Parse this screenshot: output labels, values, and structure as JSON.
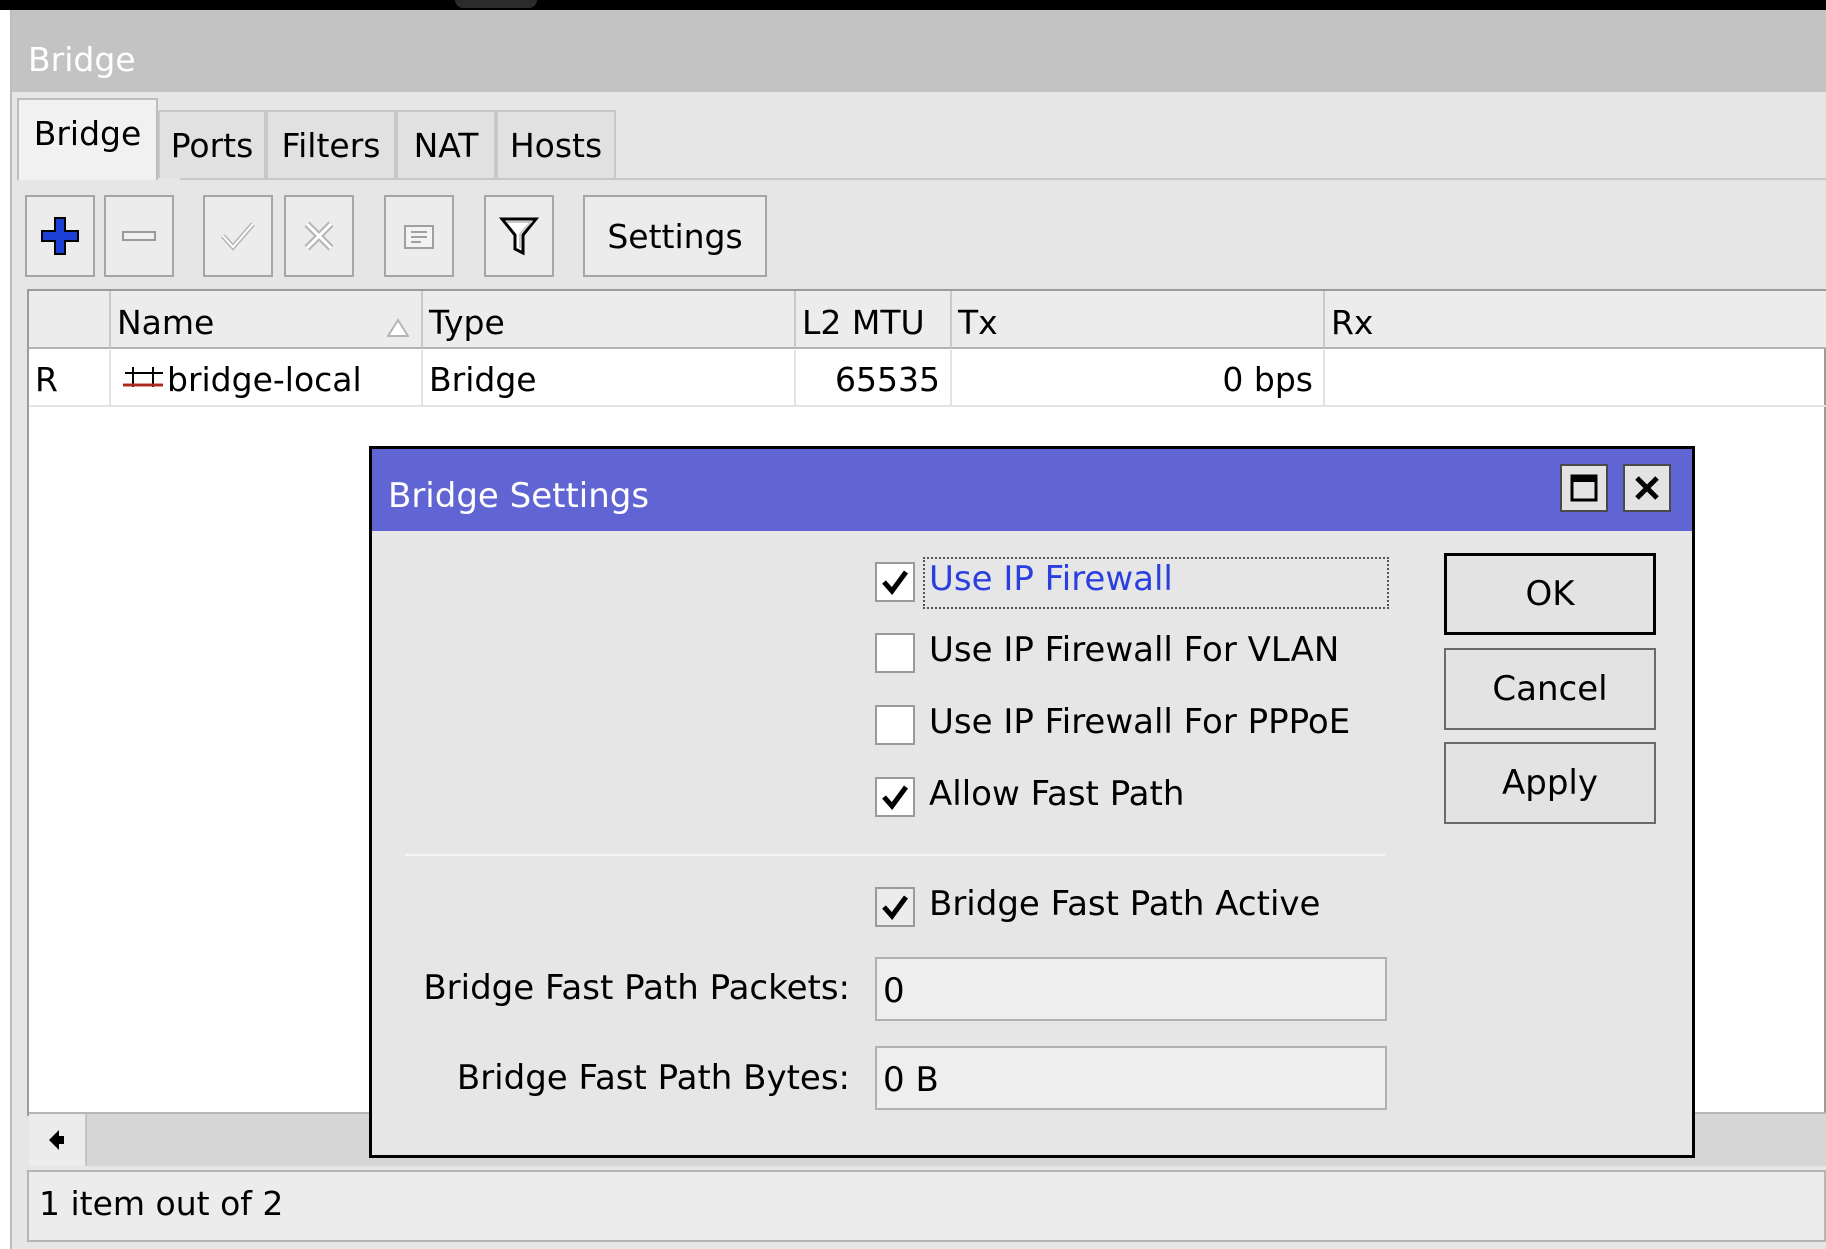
{
  "window": {
    "title": "Bridge"
  },
  "tabs": [
    "Bridge",
    "Ports",
    "Filters",
    "NAT",
    "Hosts"
  ],
  "toolbar": {
    "icons": [
      "add-icon",
      "remove-icon",
      "enable-icon",
      "disable-icon",
      "comment-icon",
      "filter-icon"
    ],
    "settings_label": "Settings"
  },
  "table": {
    "columns": [
      "",
      "Name",
      "Type",
      "L2 MTU",
      "Tx",
      "Rx"
    ],
    "rows": [
      {
        "flag": "R",
        "name": "bridge-local",
        "type": "Bridge",
        "l2mtu": "65535",
        "tx": "0 bps",
        "rx": ""
      }
    ]
  },
  "status": {
    "text": "1 item out of 2"
  },
  "dialog": {
    "title": "Bridge Settings",
    "checkboxes": [
      {
        "label": "Use IP Firewall",
        "checked": true
      },
      {
        "label": "Use IP Firewall For VLAN",
        "checked": false
      },
      {
        "label": "Use IP Firewall For PPPoE",
        "checked": false
      },
      {
        "label": "Allow Fast Path",
        "checked": true
      },
      {
        "label": "Bridge Fast Path Active",
        "checked": true
      }
    ],
    "fields": [
      {
        "label": "Bridge Fast Path Packets:",
        "value": "0"
      },
      {
        "label": "Bridge Fast Path Bytes:",
        "value": "0 B"
      }
    ],
    "buttons": {
      "ok": "OK",
      "cancel": "Cancel",
      "apply": "Apply"
    },
    "colors": {
      "titlebar": "#6165d3",
      "focused_label": "#2b3fe0"
    }
  }
}
